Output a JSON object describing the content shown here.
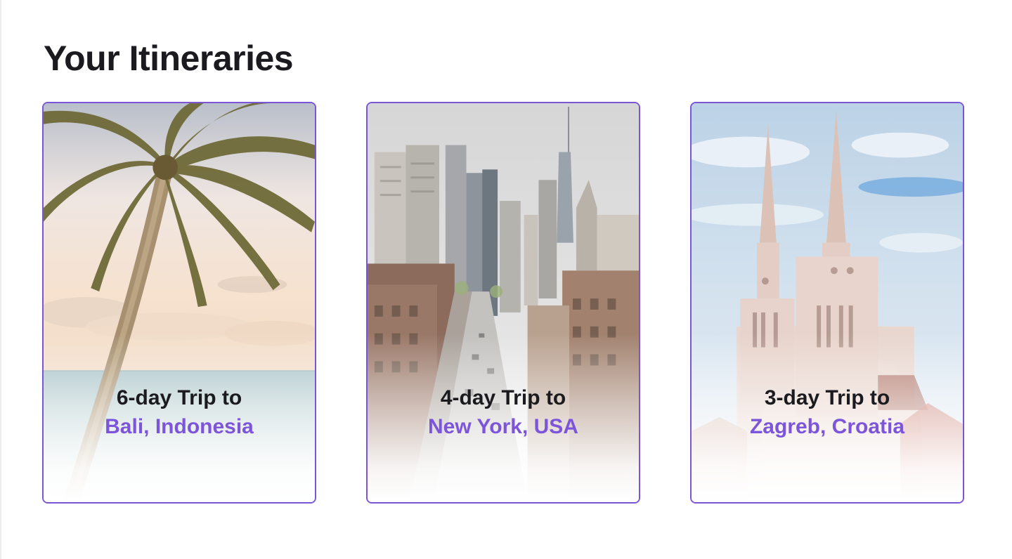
{
  "page": {
    "title": "Your Itineraries"
  },
  "itineraries": [
    {
      "trip": "6-day Trip to",
      "destination": "Bali, Indonesia",
      "image": "palm-beach-photo"
    },
    {
      "trip": "4-day Trip to",
      "destination": "New York, USA",
      "image": "city-street-photo"
    },
    {
      "trip": "3-day Trip to",
      "destination": "Zagreb, Croatia",
      "image": "cathedral-photo"
    }
  ],
  "colors": {
    "accent": "#7c55db",
    "border": "#7a55d8",
    "heading": "#1a1a1f"
  }
}
